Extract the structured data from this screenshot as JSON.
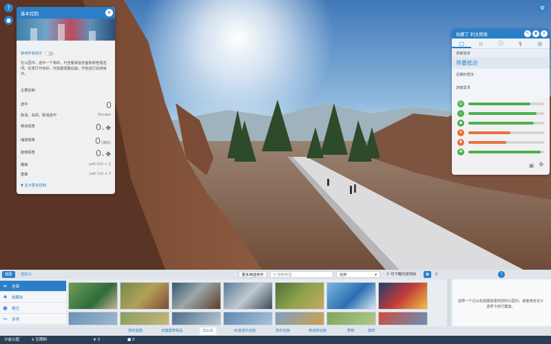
{
  "controls_panel": {
    "title": "基本控制",
    "disable_tips": "禁用所有提示",
    "intro": "在公园中，选中一个物体，可查看其信息面板和管理选项。任意打开目标，可拍摄调整后面，开始进行后续操作。",
    "section_title": "主要控制",
    "rows": [
      {
        "label": "选中",
        "key": ""
      },
      {
        "label": "取消、关闭、取消选中",
        "key": "Escape"
      },
      {
        "label": "移动视角",
        "key": ""
      },
      {
        "label": "缩放视角",
        "key": "(滚动)"
      },
      {
        "label": "旋转视角",
        "key": ""
      },
      {
        "label": "撤销",
        "key": "Left Ctrl + Z"
      },
      {
        "label": "重做",
        "key": "Left Ctrl + Y"
      }
    ],
    "more_controls": "显示更多控制"
  },
  "guest_panel": {
    "title": "伯娜丁 利文斯敦",
    "sub_label": "游客信息",
    "status": "将要抵达",
    "recent_label": "近期的想法",
    "needs_label": "游客需求",
    "needs": [
      {
        "icon": "smiley-icon",
        "color": "#4caf50",
        "value": 0.82
      },
      {
        "icon": "drink-icon",
        "color": "#4caf50",
        "value": 0.9
      },
      {
        "icon": "food-icon",
        "color": "#4caf50",
        "value": 0.86
      },
      {
        "icon": "toilet-icon",
        "color": "#e8703a",
        "value": 0.55
      },
      {
        "icon": "energy-icon",
        "color": "#e8703a",
        "value": 0.5
      },
      {
        "icon": "health-icon",
        "color": "#4caf50",
        "value": 0.95
      }
    ]
  },
  "bottom_panel": {
    "tab_active": "蓝图",
    "tab_custom": "自定义",
    "filter_button": "更多筛选条件",
    "search_placeholder": "搜索类型",
    "sort_label": "名称",
    "download_label": "可下载内容项目",
    "categories": [
      "全部",
      "收藏夹",
      "看过",
      "多项"
    ],
    "info_text": "选择一个过山车蓝图放置到您的公园内，或者用自定义选项卡自行建造。",
    "tabs": [
      "我的蓝图",
      "创建建筑物品",
      "过山车",
      "轨道游乐设施",
      "游乐设施",
      "商店和设施",
      "景物",
      "建筑"
    ]
  },
  "footer": {
    "park_label": "沙盒公园",
    "money": "无限制",
    "guests": "0",
    "rating": "0"
  },
  "colors": {
    "accent": "#2a7fc8",
    "good": "#4caf50",
    "warn": "#e8703a"
  }
}
